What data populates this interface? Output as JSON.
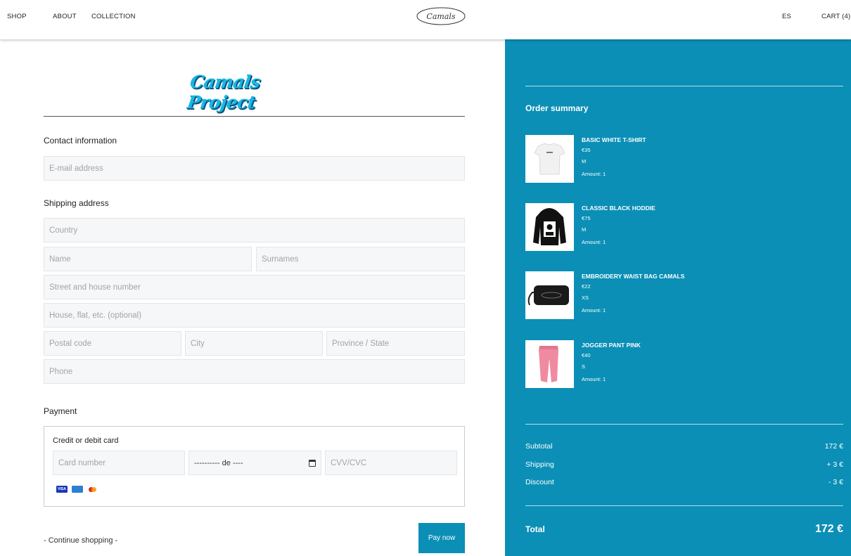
{
  "nav": {
    "links": [
      "SHOP",
      "ABOUT",
      "COLLECTION"
    ],
    "logo_text": "Camals",
    "language": "ES",
    "cart": "CART (4)"
  },
  "brand": {
    "text": "Camals Project"
  },
  "contact": {
    "title": "Contact information",
    "email_placeholder": "E-mail address"
  },
  "shipping": {
    "title": "Shipping address",
    "country_placeholder": "Country",
    "name_placeholder": "Name",
    "surnames_placeholder": "Surnames",
    "street_placeholder": "Street and house number",
    "house_placeholder": "House, flat, etc. (optional)",
    "postal_placeholder": "Postal code",
    "city_placeholder": "City",
    "province_placeholder": "Province / State",
    "phone_placeholder": "Phone"
  },
  "payment": {
    "title": "Payment",
    "method_label": "Credit or debit card",
    "card_number_placeholder": "Card number",
    "expiry_value": "---------- de ----",
    "cvv_placeholder": "CVV/CVC",
    "card_brands": [
      "VISA",
      "AMEX",
      "Mastercard"
    ]
  },
  "actions": {
    "continue": "- Continue shopping -",
    "pay": "Pay now"
  },
  "summary": {
    "title": "Order summary",
    "items": [
      {
        "name": "BASIC WHITE T-SHIRT",
        "price": "€35",
        "size": "M",
        "amount": "Amount: 1",
        "thumb": "white-tshirt"
      },
      {
        "name": "CLASSIC BLACK HODDIE",
        "price": "€75",
        "size": "M",
        "amount": "Amount: 1",
        "thumb": "black-hoodie"
      },
      {
        "name": "EMBROIDERY WAIST BAG CAMALS",
        "price": "€22",
        "size": "XS",
        "amount": "Amount: 1",
        "thumb": "waist-bag"
      },
      {
        "name": "JOGGER PANT PINK",
        "price": "€40",
        "size": "S",
        "amount": "Amount: 1",
        "thumb": "pink-jogger"
      }
    ],
    "subtotal_label": "Subtotal",
    "subtotal_value": "172 €",
    "shipping_label": "Shipping",
    "shipping_value": "+ 3 €",
    "discount_label": "Discount",
    "discount_value": "- 3 €",
    "total_label": "Total",
    "total_value": "172 €"
  },
  "colors": {
    "accent": "#0b8fb6",
    "brand_cyan": "#19b7e6",
    "field_bg": "#f6f7f8"
  }
}
